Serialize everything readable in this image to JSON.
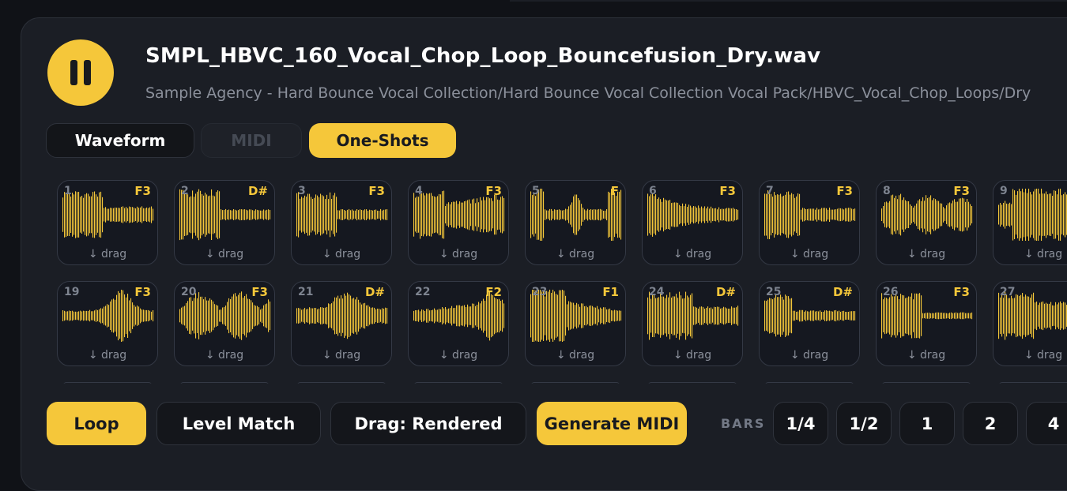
{
  "sample": {
    "filename": "SMPL_HBVC_160_Vocal_Chop_Loop_Bouncefusion_Dry.wav",
    "path": "Sample Agency - Hard Bounce Vocal Collection/Hard Bounce Vocal Collection Vocal Pack/HBVC_Vocal_Chop_Loops/Dry",
    "play_state_icon": "pause-icon"
  },
  "tabs": [
    {
      "label": "Waveform",
      "state": "inactive"
    },
    {
      "label": "MIDI",
      "state": "disabled"
    },
    {
      "label": "One-Shots",
      "state": "active"
    }
  ],
  "one_shots": {
    "drag_label": "↓ drag",
    "row1": [
      {
        "num": "1",
        "key": "F3"
      },
      {
        "num": "2",
        "key": "D#"
      },
      {
        "num": "3",
        "key": "F3"
      },
      {
        "num": "4",
        "key": "F3"
      },
      {
        "num": "5",
        "key": "F"
      },
      {
        "num": "6",
        "key": "F3"
      },
      {
        "num": "7",
        "key": "F3"
      },
      {
        "num": "8",
        "key": "F3"
      },
      {
        "num": "9",
        "key": ""
      }
    ],
    "row2": [
      {
        "num": "19",
        "key": "F3"
      },
      {
        "num": "20",
        "key": "F3"
      },
      {
        "num": "21",
        "key": "D#"
      },
      {
        "num": "22",
        "key": "F2"
      },
      {
        "num": "23",
        "key": "F1"
      },
      {
        "num": "24",
        "key": "D#"
      },
      {
        "num": "25",
        "key": "D#"
      },
      {
        "num": "26",
        "key": "F3"
      },
      {
        "num": "27",
        "key": ""
      }
    ]
  },
  "controls": {
    "loop": "Loop",
    "level_match": "Level Match",
    "drag_mode": "Drag: Rendered",
    "generate_midi": "Generate MIDI",
    "bars_label": "BARS",
    "bars": [
      "1/4",
      "1/2",
      "1",
      "2",
      "4"
    ]
  },
  "colors": {
    "accent": "#f5c73a",
    "panel": "#1b1e25",
    "background": "#101217"
  }
}
